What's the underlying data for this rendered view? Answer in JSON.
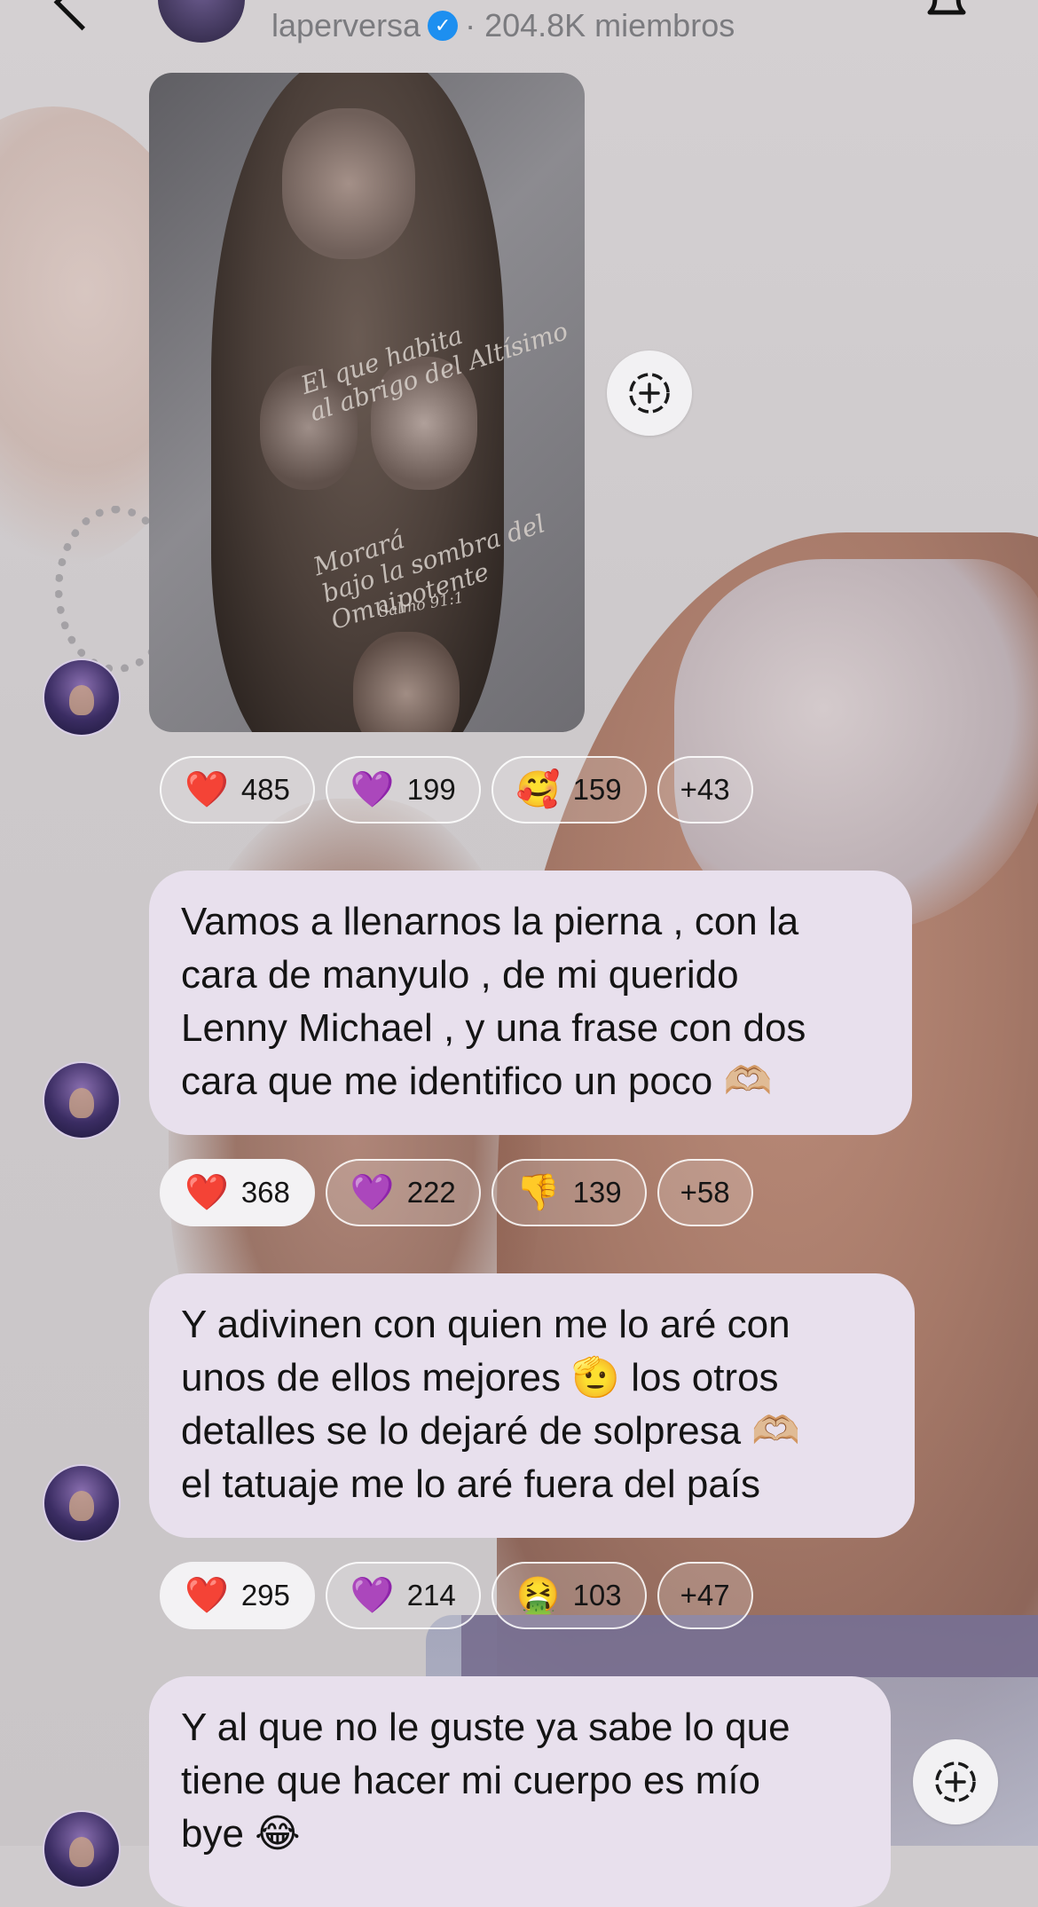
{
  "header": {
    "channel_name": "laperversa",
    "members": "· 204.8K miembros"
  },
  "image_message": {
    "tattoo_text_1": "El que habita\nal abrigo del Altísimo",
    "tattoo_text_2": "Morará\nbajo la sombra del\nOmnipotente",
    "tattoo_text_3": "Salmo 91:1",
    "reactions": [
      {
        "emoji": "❤️",
        "count": "485"
      },
      {
        "emoji": "💜",
        "count": "199"
      },
      {
        "emoji": "🥰",
        "count": "159"
      },
      {
        "more": "+43"
      }
    ]
  },
  "messages": [
    {
      "text": "Vamos a llenarnos la pierna , con la\ncara de manyulo , de mi querido\nLenny Michael , y una frase con dos\ncara que me identifico un poco 🫶🏼",
      "reactions": [
        {
          "emoji": "❤️",
          "count": "368"
        },
        {
          "emoji": "💜",
          "count": "222"
        },
        {
          "emoji": "👎",
          "count": "139"
        },
        {
          "more": "+58"
        }
      ]
    },
    {
      "text": "Y adivinen con quien me lo aré con\nunos de ellos mejores 🫡 los otros\ndetalles se lo dejaré de solpresa 🫶🏼\nel tatuaje me lo aré fuera del país",
      "reactions": [
        {
          "emoji": "❤️",
          "count": "295"
        },
        {
          "emoji": "💜",
          "count": "214"
        },
        {
          "emoji": "🤮",
          "count": "103"
        },
        {
          "more": "+47"
        }
      ]
    },
    {
      "text": "Y al que no le guste ya sabe lo que\ntiene que hacer mi cuerpo es mío\nbye 😂"
    }
  ],
  "icons": {
    "back": "back-icon",
    "verified": "verified-badge-icon",
    "bell": "bell-icon",
    "share": "share-circle-plus-icon"
  },
  "colors": {
    "bubble": "#e8e0ed",
    "selected_pill": "#f3f2f4",
    "verified": "#1d8ff0"
  }
}
